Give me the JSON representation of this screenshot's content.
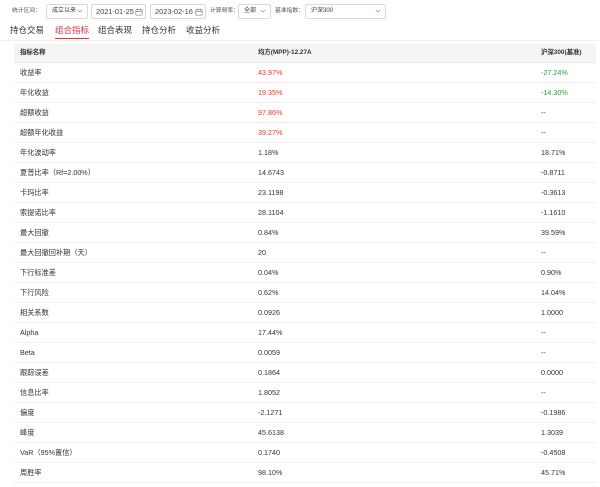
{
  "filters": {
    "period_label": "统计区间：",
    "period_value": "成立以来",
    "start_date": "2021-01-25",
    "end_date": "2023-02-16",
    "freq_label": "计算频率：",
    "freq_value": "全部",
    "benchmark_label": "基准指数：",
    "benchmark_value": "沪深300"
  },
  "tabs": [
    {
      "label": "持仓交易",
      "active": false
    },
    {
      "label": "组合指标",
      "active": true
    },
    {
      "label": "组合表现",
      "active": false
    },
    {
      "label": "持仓分析",
      "active": false
    },
    {
      "label": "收益分析",
      "active": false
    }
  ],
  "icons": {
    "select": "chevron-down-icon",
    "date": "calendar-icon"
  },
  "colors": {
    "accent": "#d9363e",
    "up": "#e63b2e",
    "down": "#27a243"
  },
  "table": {
    "headers": [
      "指标名称",
      "均方(MPP)-12.27A",
      "沪深300(基准)"
    ],
    "rows": [
      {
        "name": "收益率",
        "fund": "43.97%",
        "bench": "-27.24%",
        "fund_tone": "up",
        "bench_tone": "down"
      },
      {
        "name": "年化收益",
        "fund": "19.35%",
        "bench": "-14.30%",
        "fund_tone": "up",
        "bench_tone": "down"
      },
      {
        "name": "超额收益",
        "fund": "97.86%",
        "bench": "--",
        "fund_tone": "up"
      },
      {
        "name": "超额年化收益",
        "fund": "39.27%",
        "bench": "--",
        "fund_tone": "up"
      },
      {
        "name": "年化波动率",
        "fund": "1.18%",
        "bench": "18.71%"
      },
      {
        "name": "夏普比率（Rf=2.00%）",
        "fund": "14.6743",
        "bench": "-0.8711"
      },
      {
        "name": "卡玛比率",
        "fund": "23.1198",
        "bench": "-0.3613"
      },
      {
        "name": "索提诺比率",
        "fund": "28.1104",
        "bench": "-1.1610"
      },
      {
        "name": "最大回撤",
        "fund": "0.84%",
        "bench": "39.59%"
      },
      {
        "name": "最大回撤回补期（天）",
        "fund": "20",
        "bench": "--"
      },
      {
        "name": "下行标准差",
        "fund": "0.04%",
        "bench": "0.90%"
      },
      {
        "name": "下行风险",
        "fund": "0.62%",
        "bench": "14.04%"
      },
      {
        "name": "相关系数",
        "fund": "0.0926",
        "bench": "1.0000"
      },
      {
        "name": "Alpha",
        "fund": "17.44%",
        "bench": "--"
      },
      {
        "name": "Beta",
        "fund": "0.0059",
        "bench": "--"
      },
      {
        "name": "跟踪误差",
        "fund": "0.1864",
        "bench": "0.0000"
      },
      {
        "name": "信息比率",
        "fund": "1.8052",
        "bench": "--"
      },
      {
        "name": "偏度",
        "fund": "-2.1271",
        "bench": "-0.1986"
      },
      {
        "name": "峰度",
        "fund": "45.6138",
        "bench": "1.3039"
      },
      {
        "name": "VaR（95%置信）",
        "fund": "0.1740",
        "bench": "-0.4508"
      },
      {
        "name": "周胜率",
        "fund": "98.10%",
        "bench": "45.71%"
      }
    ]
  }
}
